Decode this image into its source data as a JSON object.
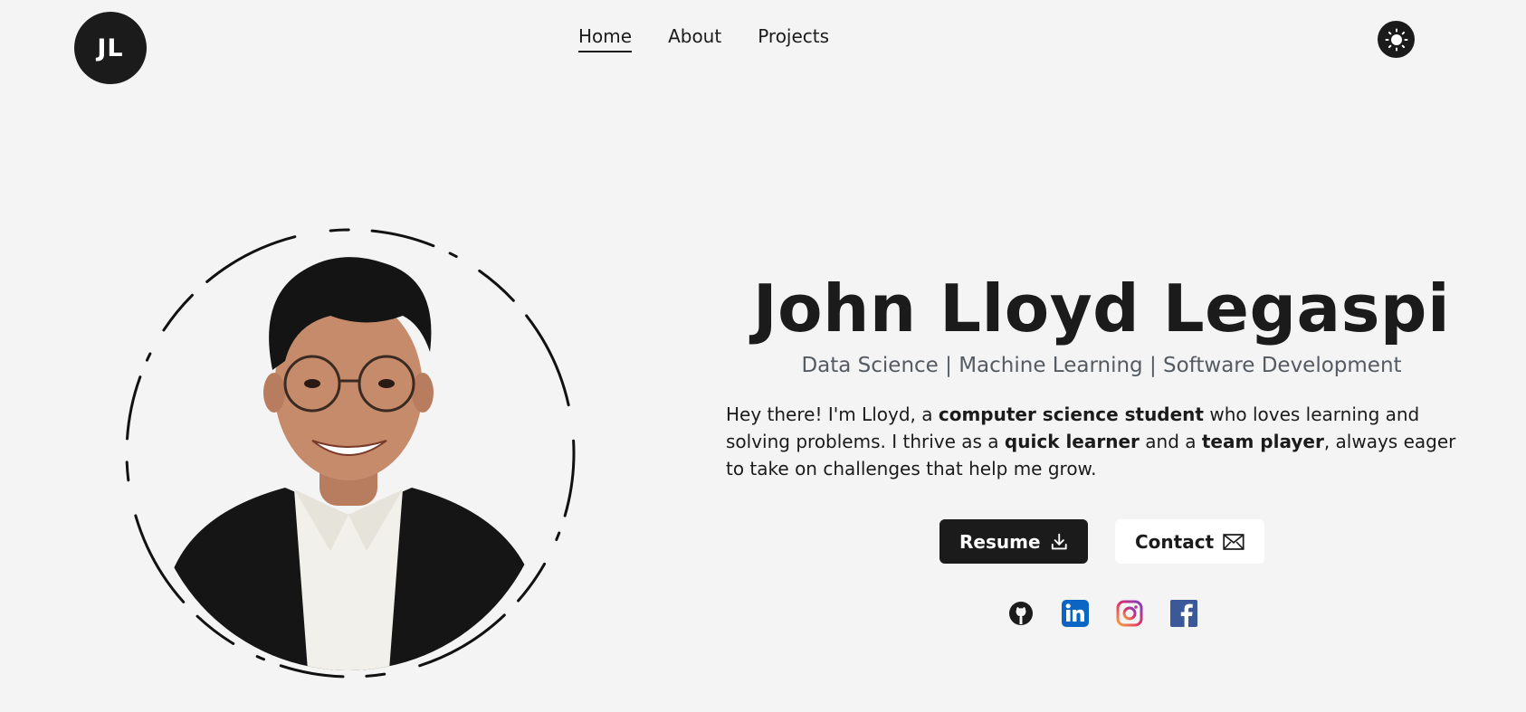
{
  "header": {
    "logo_text": "JL",
    "nav": [
      {
        "label": "Home",
        "active": true
      },
      {
        "label": "About",
        "active": false
      },
      {
        "label": "Projects",
        "active": false
      }
    ],
    "theme_icon": "sun-icon"
  },
  "hero": {
    "name": "John Lloyd Legaspi",
    "subtitle": "Data Science | Machine Learning | Software Development",
    "bio": {
      "p1": "Hey there! I'm Lloyd, a ",
      "b1": "computer science student",
      "p2": " who loves learning and solving problems. I thrive as a ",
      "b2": "quick learner",
      "p3": " and a ",
      "b3": "team player",
      "p4": ", always eager to take on challenges that help me grow."
    },
    "buttons": {
      "resume_label": "Resume",
      "resume_icon": "download-icon",
      "contact_label": "Contact",
      "contact_icon": "envelope-icon"
    },
    "socials": [
      "github-icon",
      "linkedin-icon",
      "instagram-icon",
      "facebook-icon"
    ],
    "colors": {
      "linkedin": "#0a66c2",
      "facebook": "#3b5998",
      "dark": "#1b1b1b",
      "background": "#f4f4f4"
    }
  }
}
